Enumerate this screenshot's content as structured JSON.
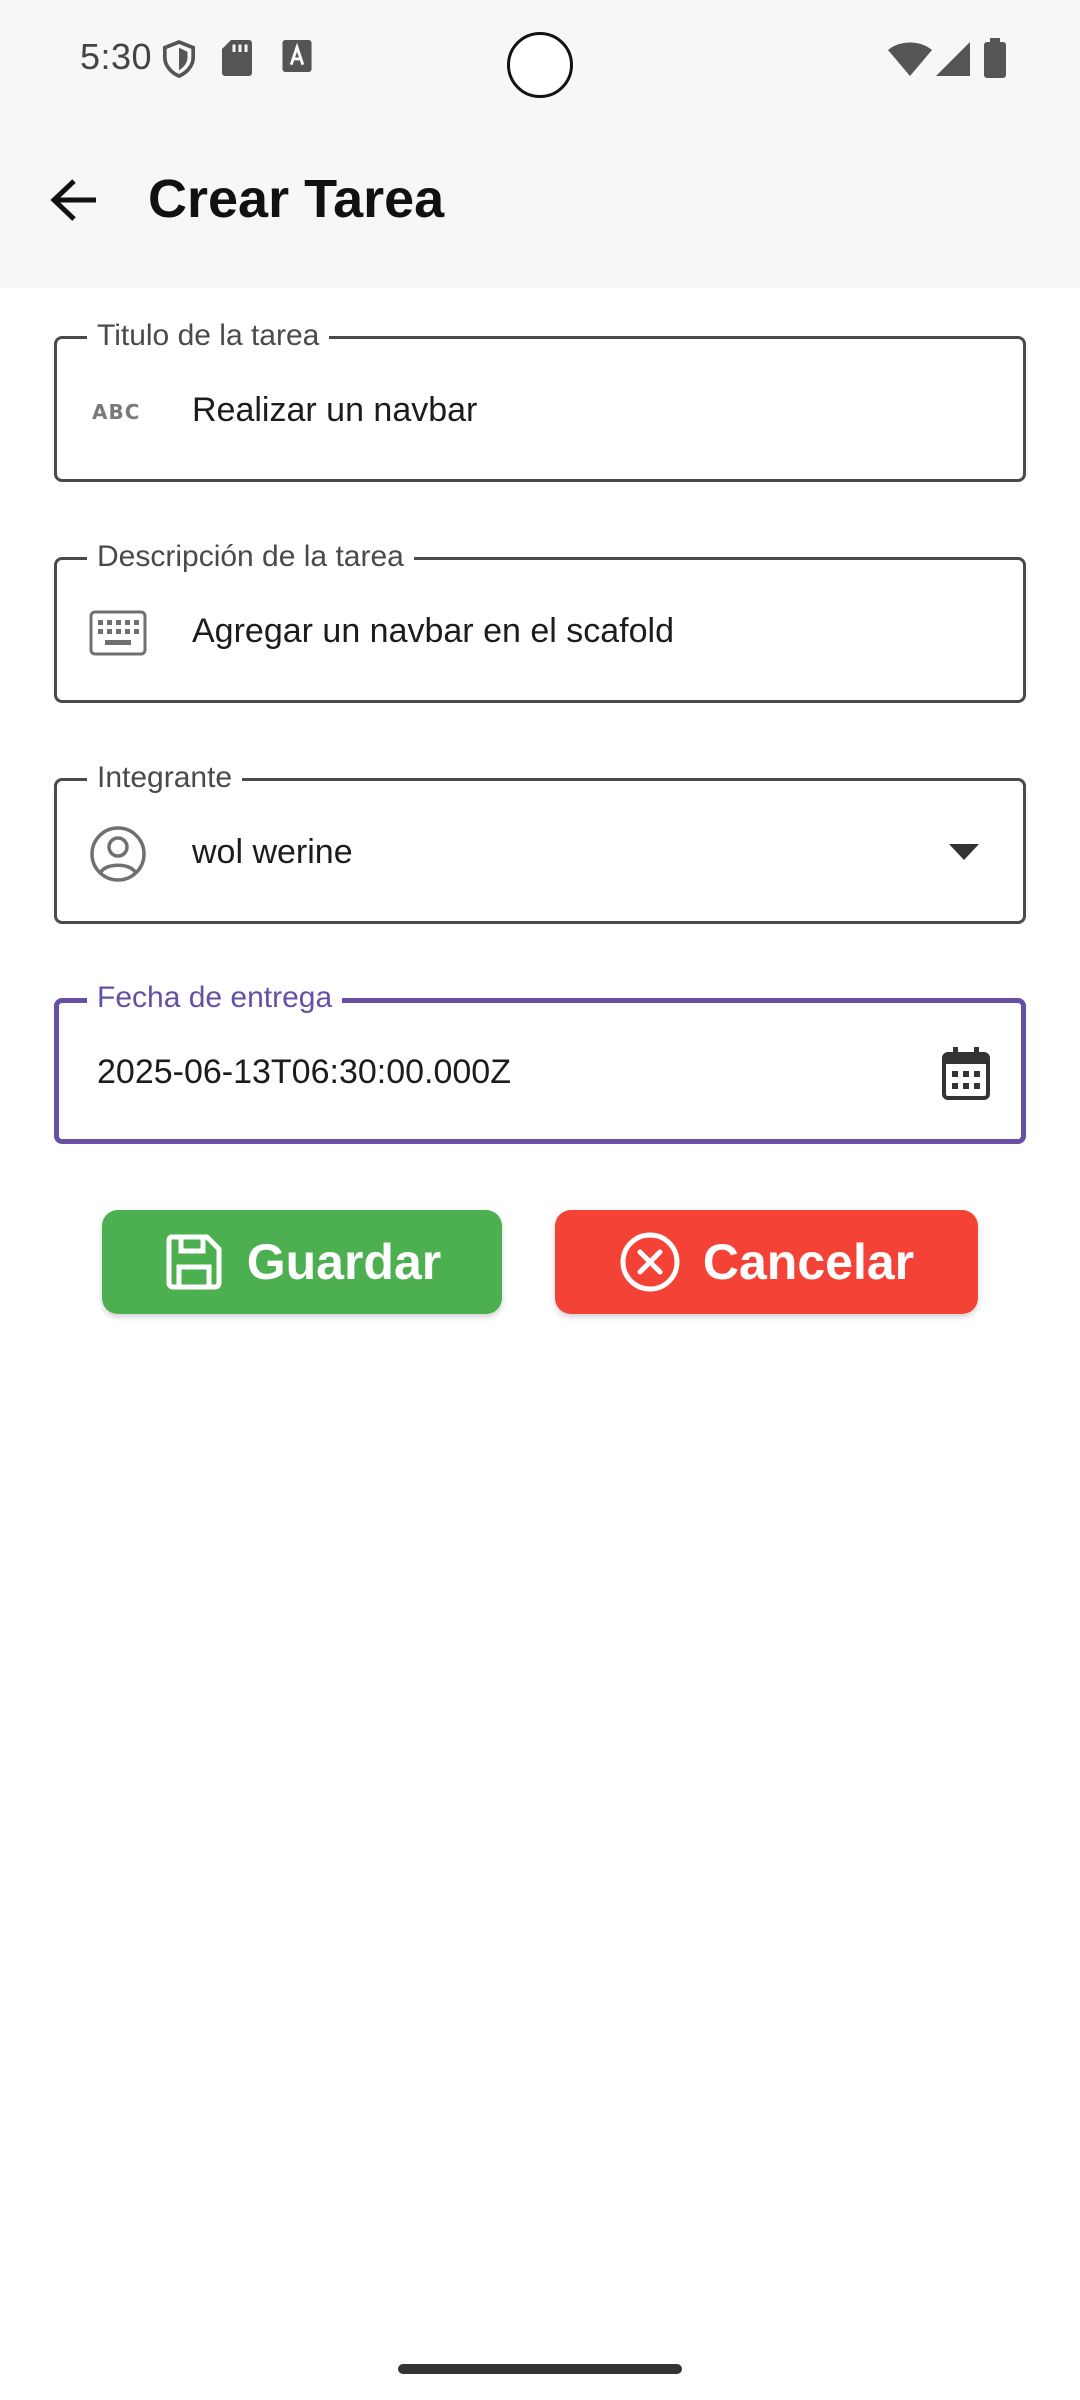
{
  "status_bar": {
    "time": "5:30",
    "left_icons": [
      "shield-icon",
      "sd-card-icon",
      "text-a-icon"
    ],
    "right_icons": [
      "wifi-icon",
      "cell-signal-icon",
      "battery-icon"
    ]
  },
  "app_bar": {
    "back_icon": "arrow-left-icon",
    "title": "Crear Tarea"
  },
  "form": {
    "title_field": {
      "label": "Titulo de la tarea",
      "value": "Realizar un navbar",
      "icon": "abc-icon"
    },
    "description_field": {
      "label": "Descripción de la tarea",
      "value": "Agregar un navbar en el scafold",
      "icon": "keyboard-icon"
    },
    "member_field": {
      "label": "Integrante",
      "value": "wol werine",
      "icon": "account-circle-icon",
      "trailing_icon": "dropdown-arrow-icon"
    },
    "date_field": {
      "label": "Fecha de entrega",
      "value": "2025-06-13T06:30:00.000Z",
      "trailing_icon": "calendar-icon",
      "focused": true
    }
  },
  "actions": {
    "save_label": "Guardar",
    "save_icon": "save-icon",
    "cancel_label": "Cancelar",
    "cancel_icon": "cancel-circle-icon"
  },
  "colors": {
    "accent": "#6750a4",
    "save": "#4caf50",
    "cancel": "#f44336",
    "app_bar_bg": "#f7f7f7",
    "outline": "#4a4a4a"
  }
}
